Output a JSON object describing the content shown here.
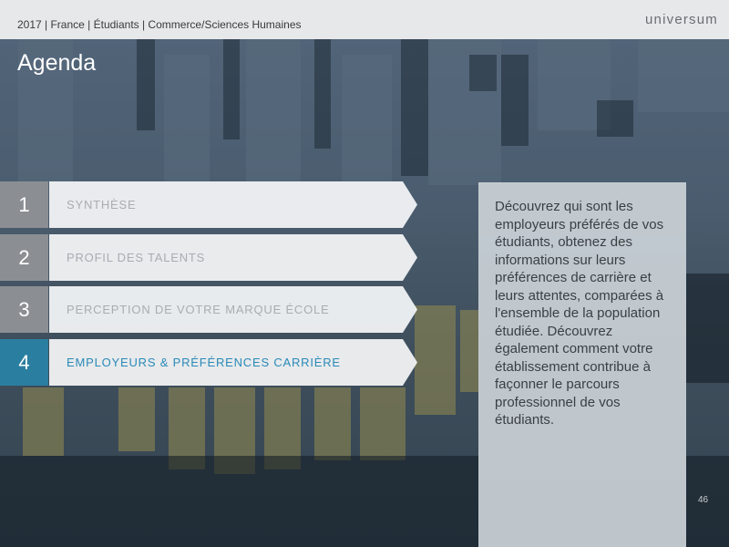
{
  "header": {
    "breadcrumb": "2017 | France | Étudiants | Commerce/Sciences Humaines",
    "logo": "universum"
  },
  "title": "Agenda",
  "agenda": [
    {
      "number": "1",
      "label": "SYNTHÈSE",
      "active": false
    },
    {
      "number": "2",
      "label": "PROFIL DES TALENTS",
      "active": false
    },
    {
      "number": "3",
      "label": "PERCEPTION DE VOTRE MARQUE ÉCOLE",
      "active": false
    },
    {
      "number": "4",
      "label": "EMPLOYEURS & PRÉFÉRENCES CARRIÈRE",
      "active": true
    }
  ],
  "panel": {
    "text": "Découvrez qui sont les employeurs préférés de vos étudiants, obtenez des informations sur leurs préférences de carrière et leurs attentes, comparées à l'ensemble de la population étudiée. Découvrez également comment votre établissement contribue à façonner le parcours professionnel de vos étudiants."
  },
  "page_number": "46",
  "colors": {
    "header_bg": "#e7e8e9",
    "number_inactive": "#8b8f94",
    "number_active": "#2a7fa0",
    "label_active": "#2a8ab8",
    "label_inactive": "#a8adb2"
  }
}
